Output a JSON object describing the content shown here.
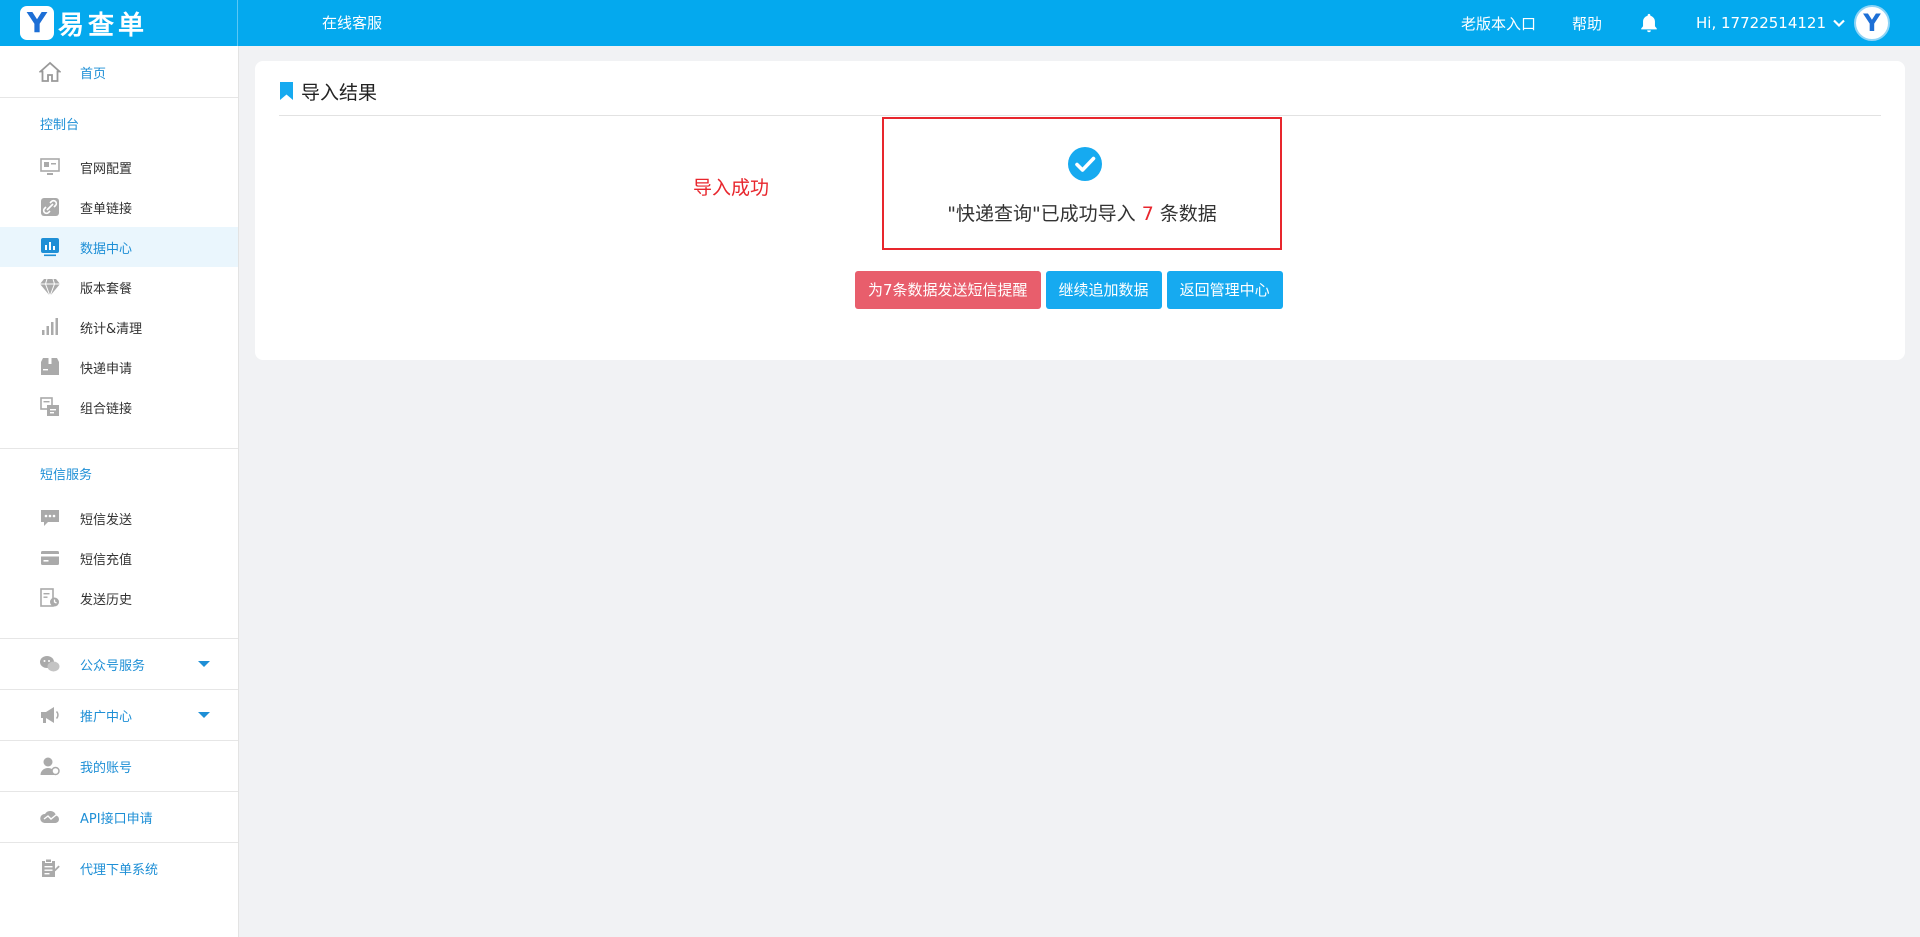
{
  "header": {
    "logo_letter": "Y",
    "logo_text": "易查单",
    "service_link": "在线客服",
    "old_version": "老版本入口",
    "help": "帮助",
    "greeting": "Hi, 17722514121",
    "avatar_letter": "Y"
  },
  "sidebar": {
    "home": "首页",
    "section_console": "控制台",
    "console_items": [
      "官网配置",
      "查单链接",
      "数据中心",
      "版本套餐",
      "统计&清理",
      "快递申请",
      "组合链接"
    ],
    "section_sms": "短信服务",
    "sms_items": [
      "短信发送",
      "短信充值",
      "发送历史"
    ],
    "wechat": "公众号服务",
    "promo": "推广中心",
    "account": "我的账号",
    "api": "API接口申请",
    "agent": "代理下单系统"
  },
  "card": {
    "title": "导入结果",
    "note": "导入成功",
    "result_prefix": "\"快递查询\"已成功导入",
    "result_count": "7",
    "result_suffix": "条数据",
    "btn_sms": "为7条数据发送短信提醒",
    "btn_continue": "继续追加数据",
    "btn_back": "返回管理中心"
  },
  "colors": {
    "header_bg": "#04a9ee",
    "accent_blue": "#1e8fd6",
    "alert_red": "#e8262d",
    "btn_red": "#e85e6c",
    "btn_blue": "#16aaf0"
  }
}
